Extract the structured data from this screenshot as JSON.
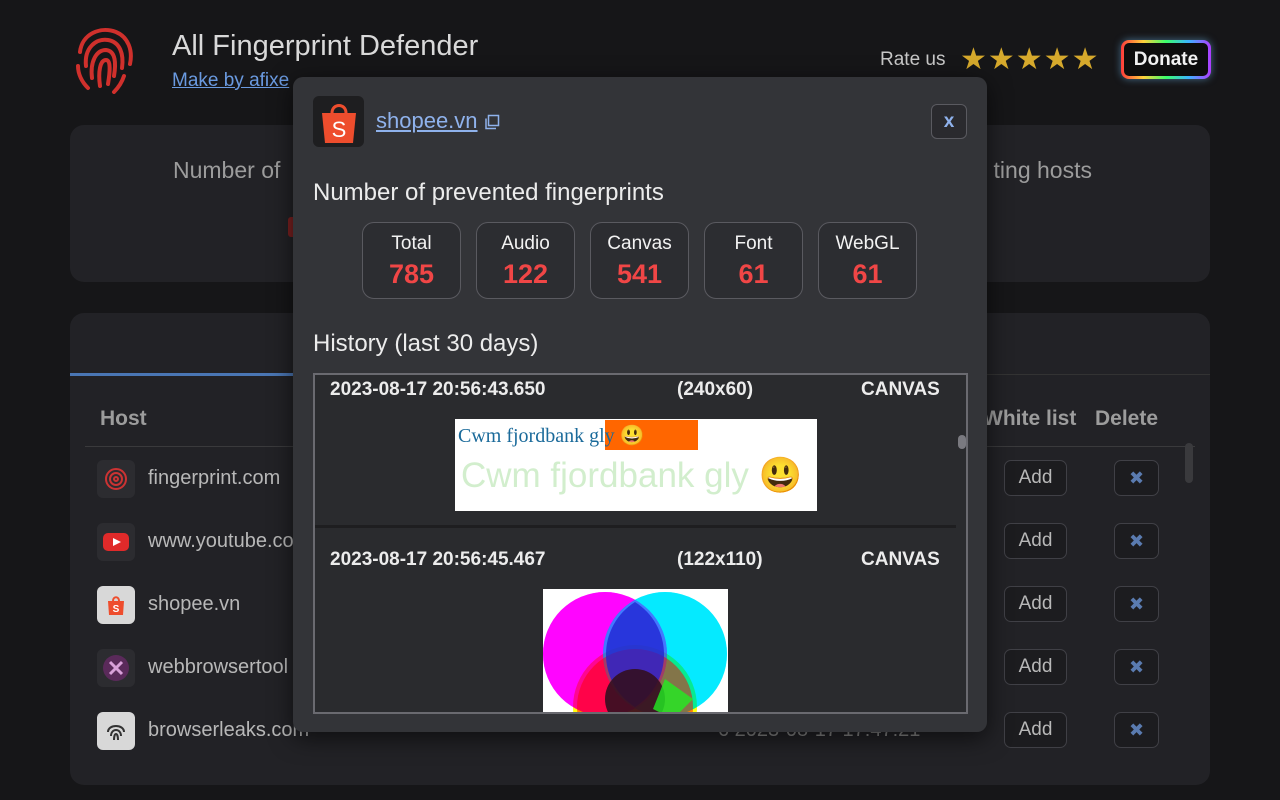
{
  "app": {
    "title": "All Fingerprint Defender",
    "author": "Make by afixe",
    "rate_label": "Rate us",
    "stars": "★★★★★",
    "donate_label": "Donate"
  },
  "summary_card": {
    "left_label": "Number of",
    "right_label": "ting hosts"
  },
  "table": {
    "headers": {
      "host": "Host",
      "white_list": "White list",
      "delete": "Delete"
    },
    "rows": [
      {
        "host": "fingerprint.com",
        "add": "Add",
        "delete": "✖",
        "extra": ""
      },
      {
        "host": "www.youtube.co",
        "add": "Add",
        "delete": "✖",
        "extra": ""
      },
      {
        "host": "shopee.vn",
        "add": "Add",
        "delete": "✖",
        "extra": ""
      },
      {
        "host": "webbrowsertool",
        "add": "Add",
        "delete": "✖",
        "extra": ""
      },
      {
        "host": "browserleaks.com",
        "add": "Add",
        "delete": "✖",
        "extra": "6     2023-08-17 17:47:21"
      }
    ]
  },
  "modal": {
    "site": "shopee.vn",
    "close_label": "x",
    "prevented_title": "Number of prevented fingerprints",
    "stats": [
      {
        "label": "Total",
        "value": "785"
      },
      {
        "label": "Audio",
        "value": "122"
      },
      {
        "label": "Canvas",
        "value": "541"
      },
      {
        "label": "Font",
        "value": "61"
      },
      {
        "label": "WebGL",
        "value": "61"
      }
    ],
    "history_title": "History (last 30 days)",
    "history": [
      {
        "time": "2023-08-17 20:56:43.650",
        "size": "(240x60)",
        "type": "CANVAS",
        "canvas_text_small": "Cwm fjordbank gly 😃",
        "canvas_text_large": "Cwm fjordbank gly 😃"
      },
      {
        "time": "2023-08-17 20:56:45.467",
        "size": "(122x110)",
        "type": "CANVAS"
      }
    ]
  },
  "colors": {
    "accent_red": "#f04646",
    "link_blue": "#8fb2ec",
    "shopee_orange": "#ee4d2d",
    "star_gold": "#d6a92c"
  },
  "icons": {
    "logo": "fingerprint-icon",
    "copy": "copy-icon",
    "close": "close-icon",
    "delete": "delete-icon"
  }
}
